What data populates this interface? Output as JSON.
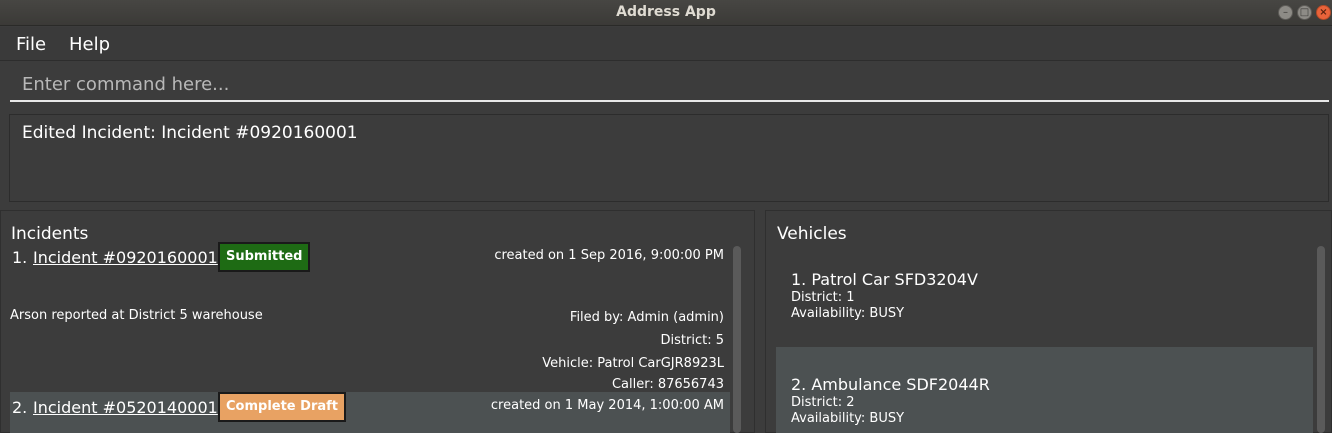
{
  "window": {
    "title": "Address App"
  },
  "menu": {
    "file": "File",
    "help": "Help"
  },
  "command": {
    "placeholder": "Enter command here...",
    "value": ""
  },
  "result": {
    "message": "Edited Incident: Incident #0920160001"
  },
  "incidents": {
    "title": "Incidents",
    "items": [
      {
        "index": "1.",
        "name": "Incident #0920160001",
        "status": "Submitted",
        "created": "created on 1 Sep 2016, 9:00:00 PM",
        "description": "Arson reported at District 5 warehouse",
        "filed_by": "Filed by: Admin (admin)",
        "district": "District: 5",
        "vehicle": "Vehicle: Patrol CarGJR8923L",
        "caller": "Caller: 87656743"
      },
      {
        "index": "2.",
        "name": "Incident #0520140001",
        "status": "Complete Draft",
        "created": "created on 1 May 2014, 1:00:00 AM"
      }
    ]
  },
  "vehicles": {
    "title": "Vehicles",
    "items": [
      {
        "heading": "1.  Patrol Car SFD3204V",
        "district": "District: 1",
        "availability": "Availability: BUSY"
      },
      {
        "heading": "2.  Ambulance SDF2044R",
        "district": "District: 2",
        "availability": "Availability: BUSY"
      }
    ]
  },
  "colors": {
    "submitted": "#1e6b14",
    "complete_draft": "#e8a263",
    "close_button": "#e9633a"
  }
}
